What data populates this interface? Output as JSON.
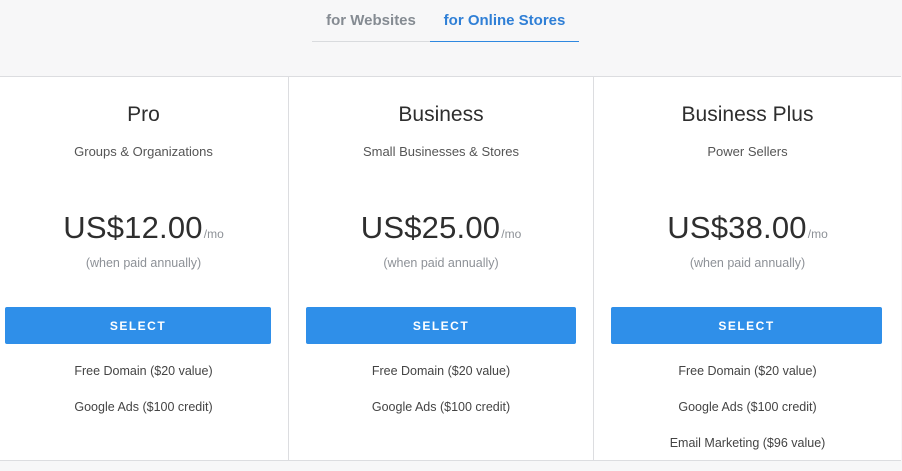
{
  "tabs": [
    {
      "label": "for Websites",
      "active": false
    },
    {
      "label": "for Online Stores",
      "active": true
    }
  ],
  "plans": [
    {
      "name": "Pro",
      "subtitle": "Groups & Organizations",
      "price": "US$12.00",
      "per": "/mo",
      "billing": "(when paid annually)",
      "button": "SELECT",
      "features": [
        "Free Domain ($20 value)",
        "Google Ads ($100 credit)"
      ]
    },
    {
      "name": "Business",
      "subtitle": "Small Businesses & Stores",
      "price": "US$25.00",
      "per": "/mo",
      "billing": "(when paid annually)",
      "button": "SELECT",
      "features": [
        "Free Domain ($20 value)",
        "Google Ads ($100 credit)"
      ]
    },
    {
      "name": "Business Plus",
      "subtitle": "Power Sellers",
      "price": "US$38.00",
      "per": "/mo",
      "billing": "(when paid annually)",
      "button": "SELECT",
      "features": [
        "Free Domain ($20 value)",
        "Google Ads ($100 credit)",
        "Email Marketing ($96 value)"
      ]
    }
  ],
  "colors": {
    "accent": "#2f8fe9",
    "active_tab": "#2f7fd6",
    "inactive_tab": "#858b92"
  }
}
